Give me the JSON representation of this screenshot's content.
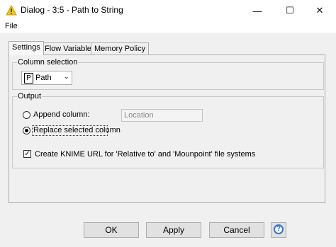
{
  "window": {
    "title": "Dialog - 3:5 - Path to String",
    "minimize_glyph": "—",
    "maximize_glyph": "☐",
    "close_glyph": "✕",
    "icon": "knime-warning-triangle-icon"
  },
  "menu": {
    "file": "File"
  },
  "tabs": [
    {
      "label": "Settings"
    },
    {
      "label": "Flow Variables"
    },
    {
      "label": "Memory Policy"
    }
  ],
  "column_selection": {
    "legend": "Column selection",
    "type_badge": "P",
    "value": "Path"
  },
  "output": {
    "legend": "Output",
    "append_label": "Append column:",
    "append_selected": false,
    "append_placeholder": "Location",
    "replace_label": "Replace selected column",
    "replace_selected": true,
    "create_url_label": "Create KNIME URL for 'Relative to' and 'Mounpoint' file systems",
    "create_url_checked": true,
    "check_glyph": "✓"
  },
  "buttons": {
    "ok": "OK",
    "apply": "Apply",
    "cancel": "Cancel",
    "help_glyph": "?"
  },
  "colors": {
    "accent": "#3874c8",
    "icon_yellow": "#f5c518"
  }
}
